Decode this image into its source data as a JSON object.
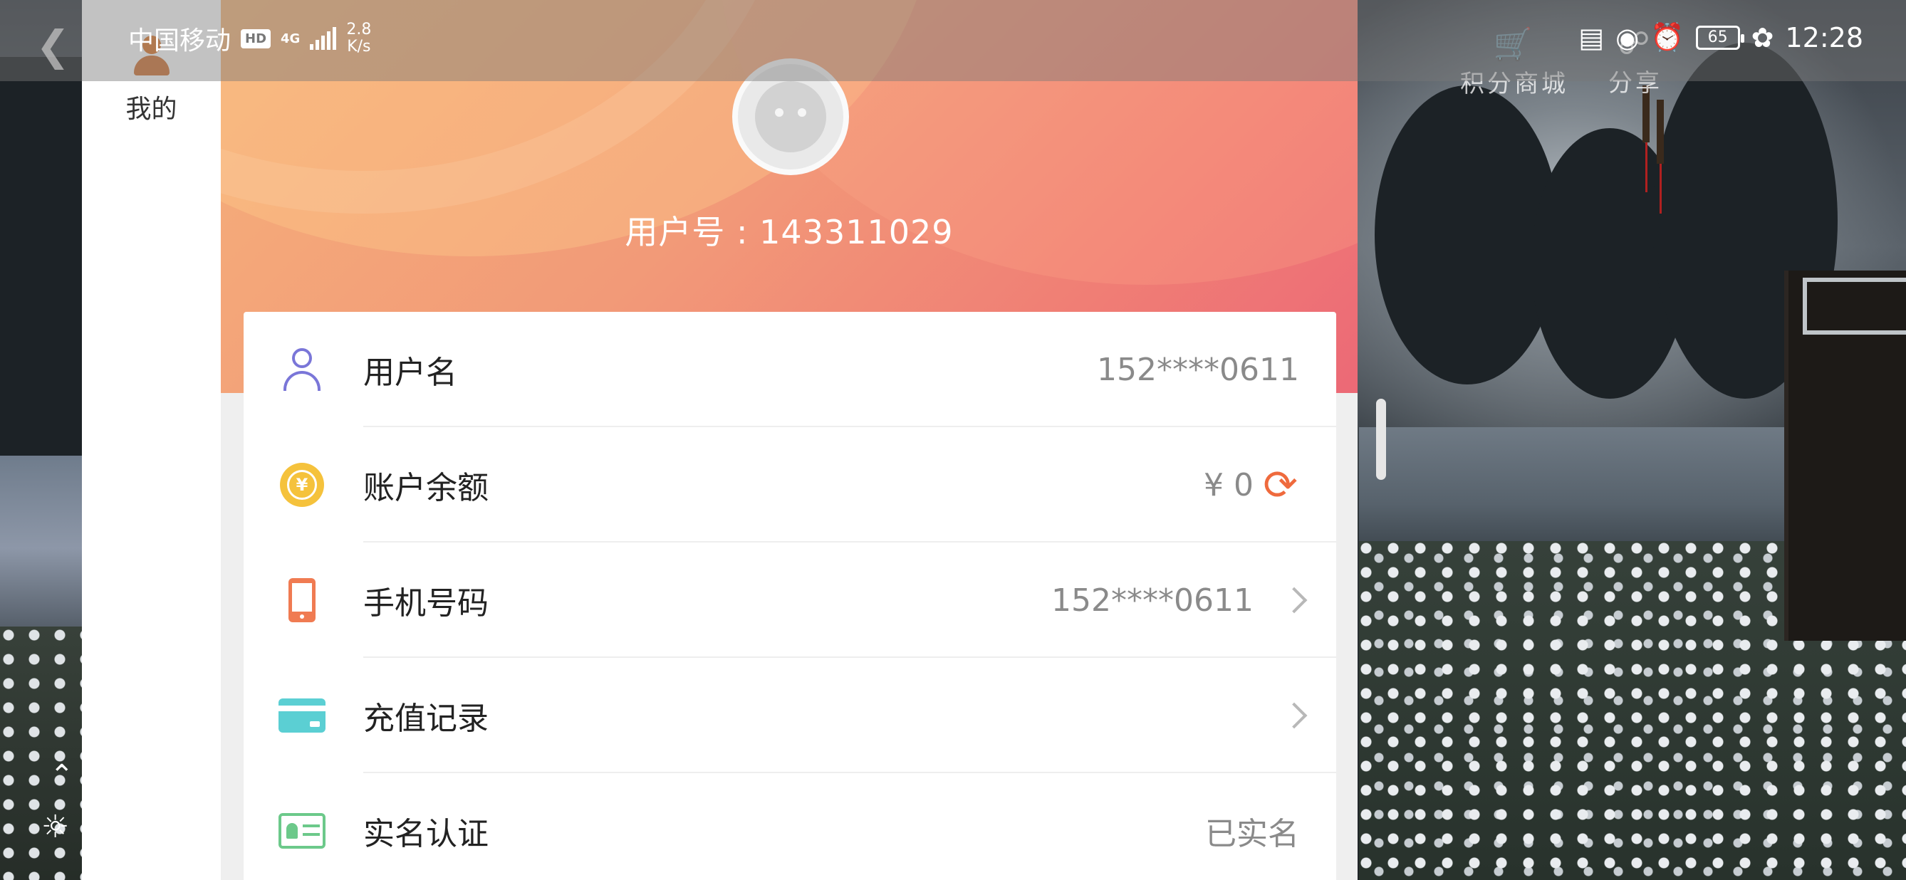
{
  "status_bar": {
    "carrier": "中国移动",
    "hd_badge": "HD",
    "network_type": "4G",
    "net_speed_value": "2.8",
    "net_speed_unit": "K/s",
    "battery": "65",
    "time": "12:28"
  },
  "game_overlay": {
    "points_mall_label": "积分商城",
    "share_label": "分享"
  },
  "sidebar": {
    "tab_mine_label": "我的"
  },
  "profile": {
    "user_no": "用户号 : 143311029"
  },
  "account_rows": [
    {
      "label": "用户名",
      "value": "152****0611",
      "icon": "user-icon",
      "icon_color": "#7a76d8"
    },
    {
      "label": "账户余额",
      "value": "¥ 0",
      "icon": "yuan-coin-icon",
      "icon_color": "#f5c23c"
    },
    {
      "label": "手机号码",
      "value": "152****0611",
      "icon": "phone-icon",
      "icon_color": "#f07b52"
    },
    {
      "label": "充值记录",
      "value": "",
      "icon": "credit-card-icon",
      "icon_color": "#5bcfd3"
    },
    {
      "label": "实名认证",
      "value": "已实名",
      "icon": "id-card-icon",
      "icon_color": "#6cc98a"
    }
  ],
  "colors": {
    "hero_gradient_start": "#f5b07a",
    "hero_gradient_end": "#ec6976",
    "refresh_accent": "#ef6a3d"
  }
}
